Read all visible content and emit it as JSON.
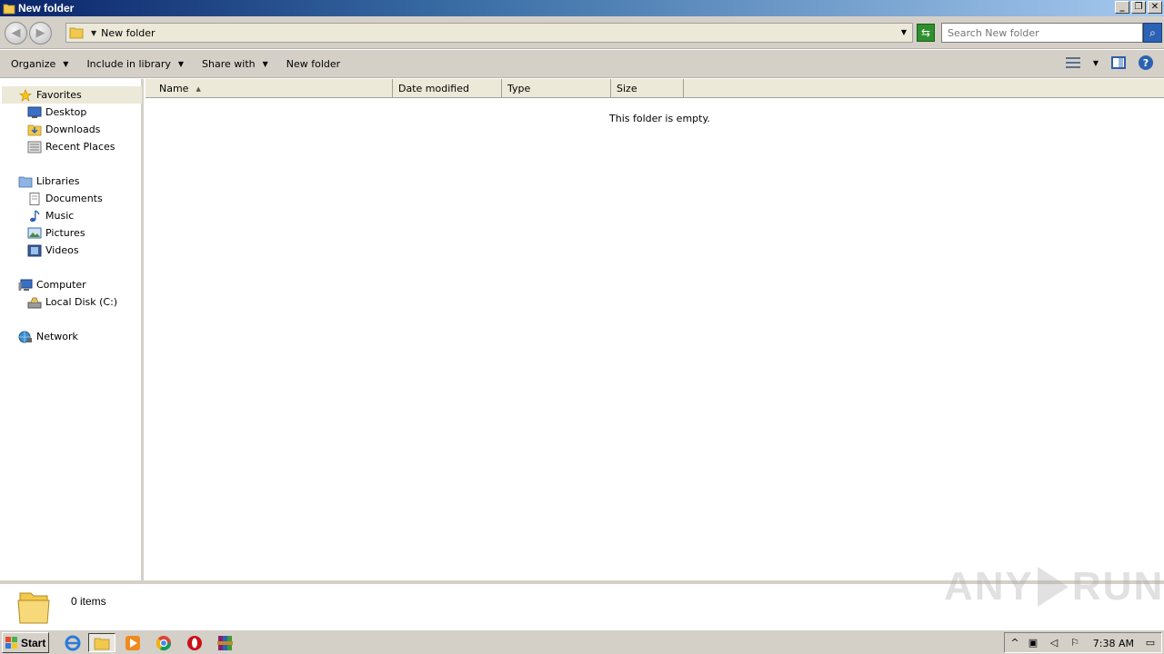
{
  "window": {
    "title": "New folder",
    "minimize_glyph": "_",
    "restore_glyph": "❐",
    "close_glyph": "✕"
  },
  "address": {
    "crumb": "New folder",
    "search_placeholder": "Search New folder"
  },
  "toolbar": {
    "organize": "Organize",
    "include_in_library": "Include in library",
    "share_with": "Share with",
    "new_folder": "New folder"
  },
  "nav": {
    "favorites": "Favorites",
    "desktop": "Desktop",
    "downloads": "Downloads",
    "recent_places": "Recent Places",
    "libraries": "Libraries",
    "documents": "Documents",
    "music": "Music",
    "pictures": "Pictures",
    "videos": "Videos",
    "computer": "Computer",
    "local_disk": "Local Disk (C:)",
    "network": "Network"
  },
  "columns": {
    "name": "Name",
    "date_modified": "Date modified",
    "type": "Type",
    "size": "Size"
  },
  "content": {
    "empty_message": "This folder is empty."
  },
  "details": {
    "item_count": "0 items"
  },
  "watermark": {
    "left": "ANY",
    "right": "RUN"
  },
  "taskbar": {
    "start": "Start",
    "clock": "7:38 AM"
  },
  "colors": {
    "titlebar_start": "#0a246a",
    "titlebar_end": "#a6caf0",
    "chrome": "#d4d0c8"
  }
}
